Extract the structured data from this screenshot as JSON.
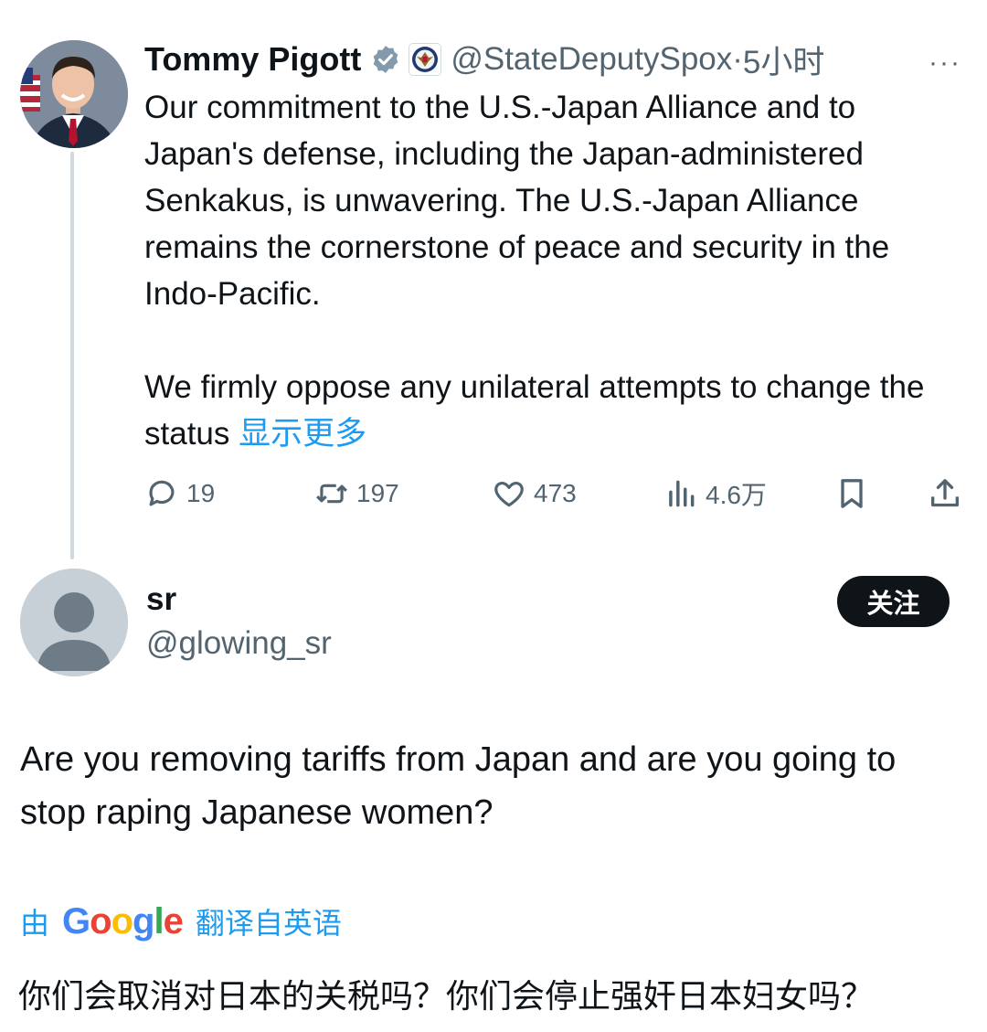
{
  "tweet": {
    "author_name": "Tommy Pigott",
    "handle": "@StateDeputySpox",
    "separator": "·",
    "time": "5小时",
    "more": "···",
    "text_p1": "Our commitment to the U.S.-Japan Alliance and to Japan's defense, including the Japan-administered Senkakus, is unwavering. The U.S.-Japan Alliance remains the cornerstone of peace and security in the Indo-Pacific.",
    "text_p2": "We firmly oppose any unilateral attempts to change the status",
    "show_more": "显示更多",
    "stats": {
      "replies": "19",
      "reposts": "197",
      "likes": "473",
      "views": "4.6万"
    },
    "icons": {
      "verified": "verified-badge-icon",
      "affiliation": "state-department-seal-icon",
      "reply": "reply-icon",
      "repost": "repost-icon",
      "like": "heart-icon",
      "views": "views-icon",
      "bookmark": "bookmark-icon",
      "share": "share-icon"
    },
    "colors": {
      "verified": "#829aab",
      "link": "#1d9bf0",
      "muted": "#536471"
    }
  },
  "reply": {
    "name": "sr",
    "handle": "@glowing_sr",
    "follow_label": "关注",
    "text": "Are you removing tariffs from Japan and are you going to stop raping Japanese women?",
    "translate_prefix": "由",
    "translate_brand": "Google",
    "translate_suffix": "翻译自英语",
    "translated_text": "你们会取消对日本的关税吗？你们会停止强奸日本妇女吗？"
  }
}
